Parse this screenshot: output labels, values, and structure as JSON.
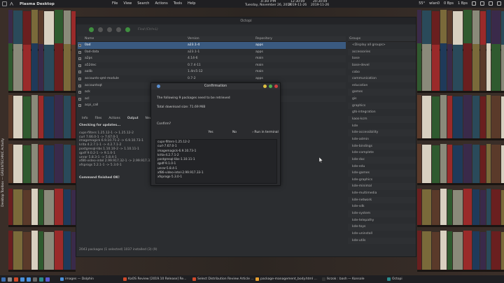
{
  "top_panel": {
    "title": "Plasma Desktop",
    "menu": [
      "File",
      "View",
      "Search",
      "Actions",
      "Tools",
      "Help"
    ],
    "clock_main": {
      "time": "3:30 PM",
      "date": "Tuesday, November 26, 2019"
    },
    "clock_second": {
      "time": "12:30:09",
      "date": "2019-11-26"
    },
    "clock_third": {
      "time": "20:30:09",
      "date": "2019-11-26"
    },
    "temp": "55°",
    "network": "wlan0",
    "net_up": "0 Bps",
    "net_down": "1 Bps"
  },
  "left_bar": {
    "activity": "Desktop Toolbox — GREENTECHNIC Activity"
  },
  "octopi": {
    "window_title": "Octopi",
    "search_placeholder": "Find (Ctrl+L)",
    "columns": {
      "name": "Name",
      "version": "Version",
      "repository": "Repository"
    },
    "packages": [
      {
        "name": "0ad",
        "version": "a23.1-4",
        "repo": "apps",
        "selected": true
      },
      {
        "name": "0ad-data",
        "version": "a23.1-1",
        "repo": "apps",
        "selected": false
      },
      {
        "name": "a2ps",
        "version": "4.14-6",
        "repo": "main",
        "selected": false
      },
      {
        "name": "a52dec",
        "version": "0.7.4-11",
        "repo": "main",
        "selected": false
      },
      {
        "name": "aalib",
        "version": "1.4rc5-12",
        "repo": "main",
        "selected": false
      },
      {
        "name": "accounts-qml-module",
        "version": "0.7-2",
        "repo": "apps",
        "selected": false
      },
      {
        "name": "accountsqt",
        "version": "",
        "repo": "",
        "selected": false
      },
      {
        "name": "ack",
        "version": "",
        "repo": "",
        "selected": false
      },
      {
        "name": "acl",
        "version": "",
        "repo": "",
        "selected": false
      },
      {
        "name": "acpi_call",
        "version": "",
        "repo": "",
        "selected": false
      }
    ],
    "groups_header": "Groups",
    "groups": [
      "<Display all groups>",
      "accessories",
      "base",
      "base-devel",
      "cobo",
      "communication",
      "education",
      "games",
      "gis",
      "graphics",
      "gtk-integration",
      "kaos-kcm",
      "kde",
      "kde-accessibility",
      "kde-admin",
      "kde-bindings",
      "kde-complete",
      "kde-doc",
      "kde-edu",
      "kde-games",
      "kde-graphics",
      "kde-minimal",
      "kde-multimedia",
      "kde-network",
      "kde-sdk",
      "kde-system",
      "kde-telepathy",
      "kde-toys",
      "kde-uninstall",
      "kde-utils"
    ],
    "lower_tabs": [
      "Info",
      "Files",
      "Actions",
      "Output",
      "News"
    ],
    "output": {
      "heading": "Checking for updates...",
      "lines": [
        "cups-filters 1.25.12-1 -> 1.25.12-2",
        "curl 7.66.0-1 -> 7.67.0-1",
        "imagemagick 6.9.10.71-2 -> 6.9.10.73-1",
        "krita 4.2.7.1-1 -> 4.2.7.1-2",
        "postgresql-libs 1.10.10-2 -> 1.10.11-1",
        "qpdf 9.0.2-1 -> 9.1.0-1",
        "unrar 5.8.3-1 -> 5.8.4-1",
        "xf86-video-intel 2.99.917.32-1 -> 2.99.917.33-1",
        "xfsprogs 5.2.1-1 -> 5.3.0-1"
      ],
      "done": "Command finished OK!"
    },
    "status": "2043 packages (1 selected)    1037 installed    (3)    (9)"
  },
  "dialog": {
    "title": "Confirmation",
    "message": "The following 9 packages need to be retrieved",
    "size": "Total download size: 71.69 MiB",
    "question": "Confirm?",
    "yes": "Yes",
    "no": "No",
    "terminal": "Run in terminal",
    "packages": [
      "cups-filters-1.25.12-2",
      "curl-7.67.0-1",
      "imagemagick-6.9.10.73-1",
      "krita-4.2.7.1-2",
      "postgresql-libs-1.10.11-1",
      "qpdf-9.1.0-1",
      "unrar-5.8.4-1",
      "xf86-video-intel-2.99.917.33-1",
      "xfsprogs-5.3.0-1"
    ]
  },
  "taskbar": {
    "tasks": [
      {
        "label": "images — Dolphin",
        "color": "#4a90d9"
      },
      {
        "label": "KaOS Review [2019.10 Release] Re...",
        "color": "#d04a2a"
      },
      {
        "label": "Select Distribution Review Article ...",
        "color": "#d04a2a"
      },
      {
        "label": "package-management_body.html ...",
        "color": "#e8a030"
      },
      {
        "label": "Ikrzok : bash — Konsole",
        "color": "#333"
      },
      {
        "label": "Octopi",
        "color": "#2a8a8a"
      }
    ]
  },
  "colors": {
    "accent": "#3a5a80",
    "panel": "#1f1f22",
    "window": "#2b2d30"
  }
}
